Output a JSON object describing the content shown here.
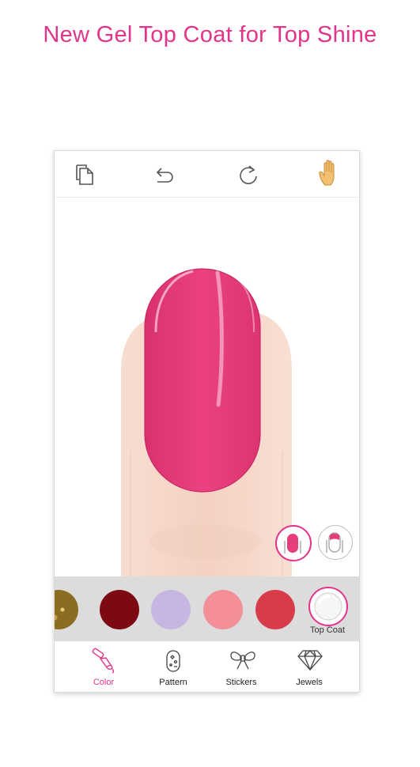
{
  "headline": "New Gel Top Coat for Top Shine",
  "toolbar": {
    "icons": [
      "copy-icon",
      "undo-icon",
      "redo-icon",
      "hand-icon"
    ]
  },
  "colors": {
    "accent": "#e3348a",
    "nail": "#e63d7d",
    "skin": "#f6d6c9"
  },
  "palette": {
    "swatches": [
      {
        "name": "gold-glitter",
        "color": "#8b6d22"
      },
      {
        "name": "dark-red",
        "color": "#7d0a12"
      },
      {
        "name": "lavender",
        "color": "#c6b7e2"
      },
      {
        "name": "salmon-pink",
        "color": "#f48e97"
      },
      {
        "name": "red",
        "color": "#d83c4a"
      }
    ],
    "topcoat_label": "Top Coat"
  },
  "tabs": [
    {
      "label": "Color",
      "icon": "nail-polish-icon",
      "active": true
    },
    {
      "label": "Pattern",
      "icon": "pattern-icon",
      "active": false
    },
    {
      "label": "Stickers",
      "icon": "bow-icon",
      "active": false
    },
    {
      "label": "Jewels",
      "icon": "diamond-icon",
      "active": false
    }
  ]
}
